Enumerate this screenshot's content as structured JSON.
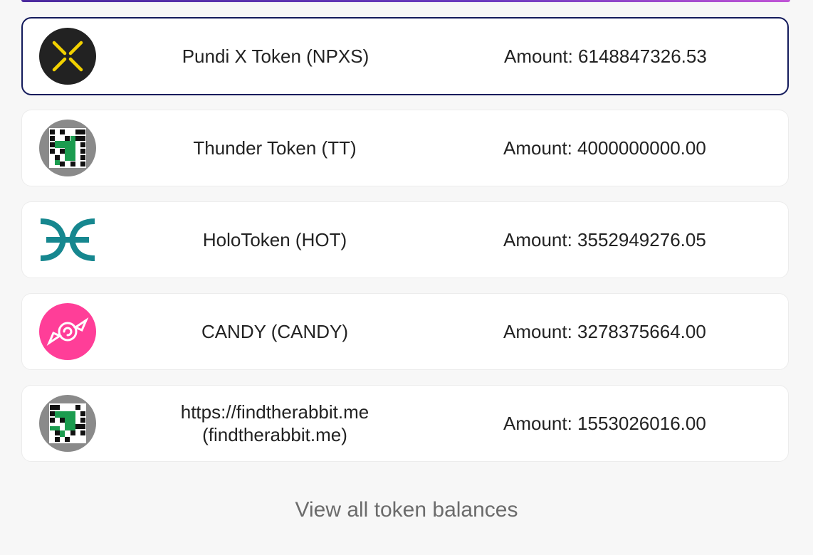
{
  "tokens": [
    {
      "name": "Pundi X Token (NPXS)",
      "amount": "Amount: 6148847326.53",
      "icon": "pundi-x-icon",
      "selected": true
    },
    {
      "name": "Thunder Token (TT)",
      "amount": "Amount: 4000000000.00",
      "icon": "identicon-icon",
      "selected": false
    },
    {
      "name": "HoloToken (HOT)",
      "amount": "Amount: 3552949276.05",
      "icon": "holo-icon",
      "selected": false
    },
    {
      "name": "CANDY (CANDY)",
      "amount": "Amount: 3278375664.00",
      "icon": "candy-icon",
      "selected": false
    },
    {
      "name_line1": "https://findtherabbit.me",
      "name_line2": "(findtherabbit.me)",
      "amount": "Amount: 1553026016.00",
      "icon": "identicon-icon",
      "selected": false
    }
  ],
  "footer": {
    "view_all_label": "View all token balances"
  },
  "colors": {
    "selected_border": "#141b5c",
    "pundi_bg": "#222222",
    "pundi_mark": "#f2d100",
    "holo_teal": "#16878f",
    "candy_pink": "#ff3e98",
    "identicon_bg": "#8a8a8a",
    "identicon_green": "#1b9c4f"
  }
}
